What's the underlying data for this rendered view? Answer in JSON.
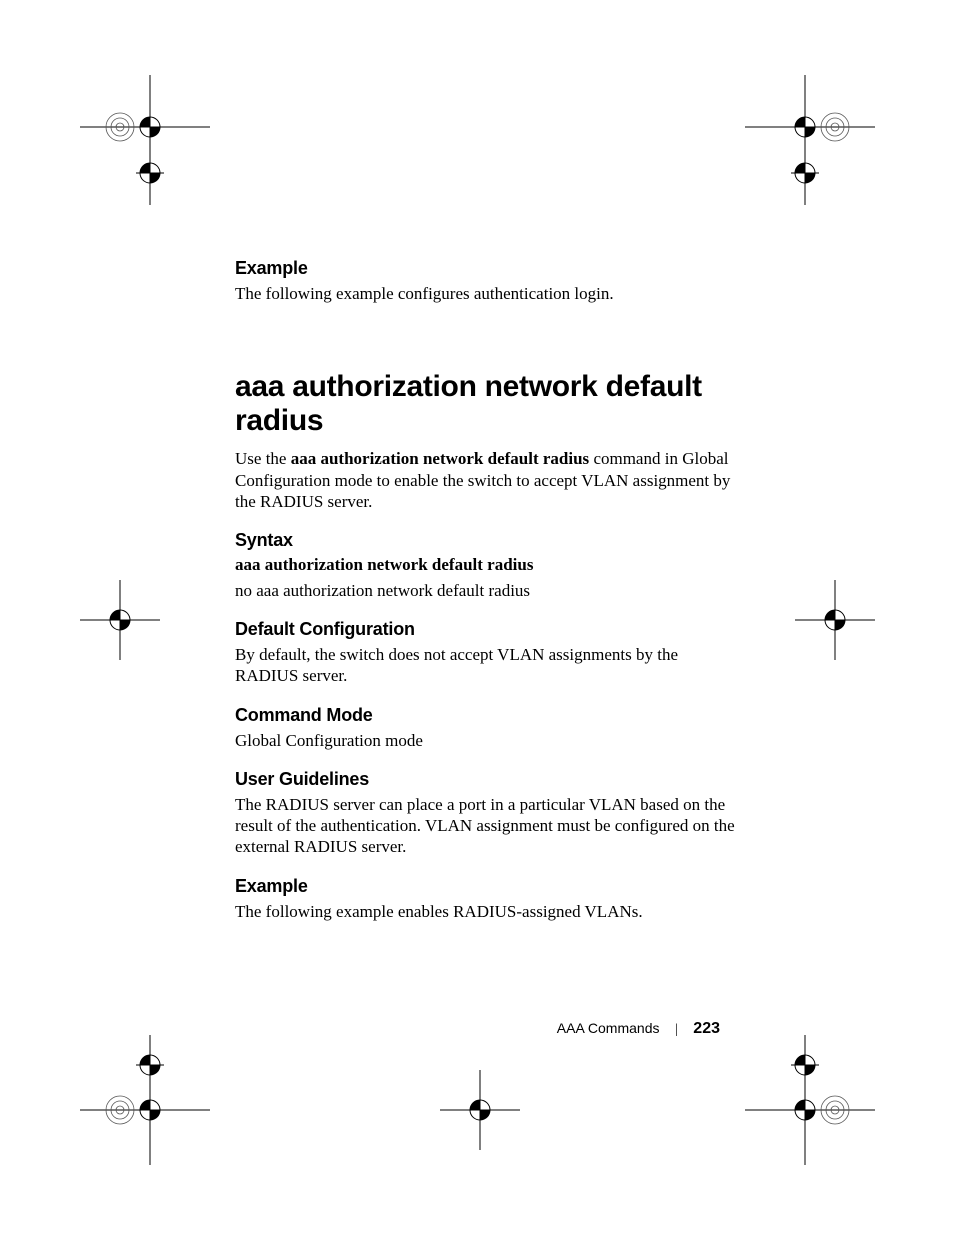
{
  "sections": {
    "example1": {
      "heading": "Example",
      "text": "The following example configures authentication login."
    },
    "mainHeading": "aaa authorization network default radius",
    "intro": {
      "prefix": "Use the ",
      "bold": "aaa authorization network default radius",
      "suffix": " command in Global Configuration mode to enable the switch to accept VLAN assignment by the RADIUS server."
    },
    "syntax": {
      "heading": "Syntax",
      "line1": "aaa authorization network default radius",
      "line2": "no aaa authorization network default radius"
    },
    "defaultConfig": {
      "heading": "Default Configuration",
      "text": "By default, the switch does not accept VLAN assignments by the RADIUS server."
    },
    "commandMode": {
      "heading": "Command Mode",
      "text": "Global Configuration mode"
    },
    "userGuidelines": {
      "heading": "User Guidelines",
      "text": "The RADIUS server can place a port in a particular VLAN based on the result of the authentication. VLAN assignment must be configured on the external RADIUS server."
    },
    "example2": {
      "heading": "Example",
      "text": "The following example enables RADIUS-assigned VLANs."
    }
  },
  "footer": {
    "label": "AAA Commands",
    "page": "223"
  }
}
